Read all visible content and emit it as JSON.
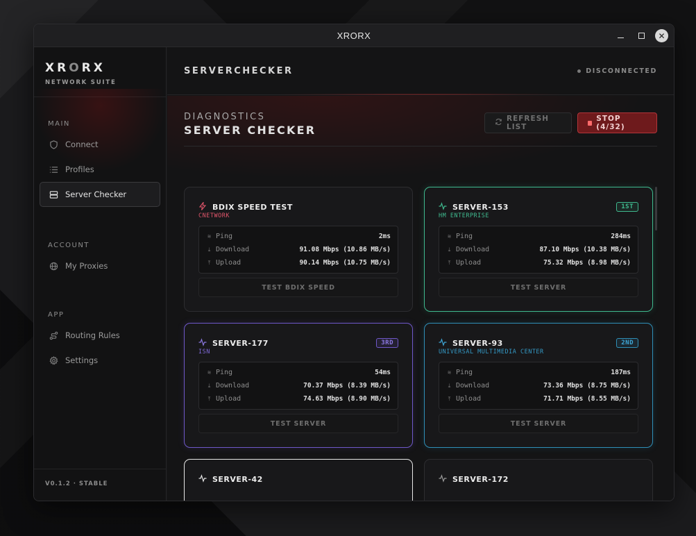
{
  "window": {
    "title": "XRORX"
  },
  "brand": {
    "logo_a": "XR",
    "logo_b": "O",
    "logo_c": "RX",
    "subtitle": "NETWORK SUITE"
  },
  "sidebar": {
    "sections": [
      {
        "heading": "MAIN",
        "items": [
          {
            "label": "Connect",
            "icon": "shield-icon"
          },
          {
            "label": "Profiles",
            "icon": "list-icon"
          },
          {
            "label": "Server Checker",
            "icon": "server-icon",
            "active": true
          }
        ]
      },
      {
        "heading": "ACCOUNT",
        "items": [
          {
            "label": "My Proxies",
            "icon": "globe-icon"
          }
        ]
      },
      {
        "heading": "APP",
        "items": [
          {
            "label": "Routing Rules",
            "icon": "route-icon"
          },
          {
            "label": "Settings",
            "icon": "gear-icon"
          }
        ]
      }
    ],
    "footer": "V0.1.2 · STABLE"
  },
  "header": {
    "title": "SERVERCHECKER",
    "status": "DISCONNECTED"
  },
  "page": {
    "eyebrow": "DIAGNOSTICS",
    "title": "SERVER CHECKER",
    "refresh_label": "REFRESH LIST",
    "stop_label": "STOP (4/32)"
  },
  "stat_labels": {
    "ping": "Ping",
    "download": "Download",
    "upload": "Upload"
  },
  "cards": [
    {
      "name": "BDIX SPEED TEST",
      "subtitle": "CNETWORK",
      "subtitle_color": "#e0556a",
      "icon": "bolt-icon",
      "accent": "#e0556a",
      "ping": "2ms",
      "download": "91.08 Mbps (10.86 MB/s)",
      "upload": "90.14 Mbps (10.75 MB/s)",
      "button": "TEST BDIX SPEED",
      "badge": ""
    },
    {
      "name": "SERVER-153",
      "subtitle": "HM ENTERPRISE",
      "subtitle_color": "#3fb98e",
      "icon": "pulse-icon",
      "accent": "#3fb98e",
      "ping": "284ms",
      "download": "87.10 Mbps (10.38 MB/s)",
      "upload": "75.32 Mbps (8.98 MB/s)",
      "button": "TEST SERVER",
      "badge": "1ST"
    },
    {
      "name": "SERVER-177",
      "subtitle": "ISN",
      "subtitle_color": "#7d68d6",
      "icon": "pulse-icon",
      "accent": "#8b78e0",
      "ping": "54ms",
      "download": "70.37 Mbps (8.39 MB/s)",
      "upload": "74.63 Mbps (8.90 MB/s)",
      "button": "TEST SERVER",
      "badge": "3RD"
    },
    {
      "name": "SERVER-93",
      "subtitle": "UNIVERSAL MULTIMEDIA CENTER",
      "subtitle_color": "#3498c4",
      "icon": "pulse-icon",
      "accent": "#3ea6d6",
      "ping": "187ms",
      "download": "73.36 Mbps (8.75 MB/s)",
      "upload": "71.71 Mbps (8.55 MB/s)",
      "button": "TEST SERVER",
      "badge": "2ND"
    },
    {
      "name": "SERVER-42",
      "icon": "pulse-icon",
      "accent": "#e6e6e6"
    },
    {
      "name": "SERVER-172",
      "icon": "pulse-icon",
      "accent": "#9a9a9a"
    }
  ],
  "colors": {
    "accent_red": "#b2353a",
    "green": "#3fb98e",
    "purple": "#6f58c9",
    "blue": "#2f8fb8"
  }
}
